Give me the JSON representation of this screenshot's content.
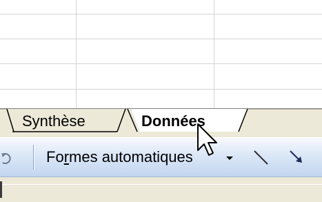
{
  "sheet_tabs": {
    "tabs": [
      {
        "label": "Synthèse",
        "active": false
      },
      {
        "label": "Données",
        "active": true
      }
    ]
  },
  "drawing_toolbar": {
    "autoshapes_label_prefix": "Fo",
    "autoshapes_label_mnemonic": "r",
    "autoshapes_label_suffix": "mes automatiques",
    "tools": [
      "autoshapes-dropdown",
      "line-tool",
      "arrow-tool"
    ]
  },
  "colors": {
    "grid_line": "#d4d4d4",
    "tab_strip": "#ece9d8",
    "toolbar_gradient_top": "#f7f9fd",
    "toolbar_gradient_bottom": "#c3d6f0"
  }
}
